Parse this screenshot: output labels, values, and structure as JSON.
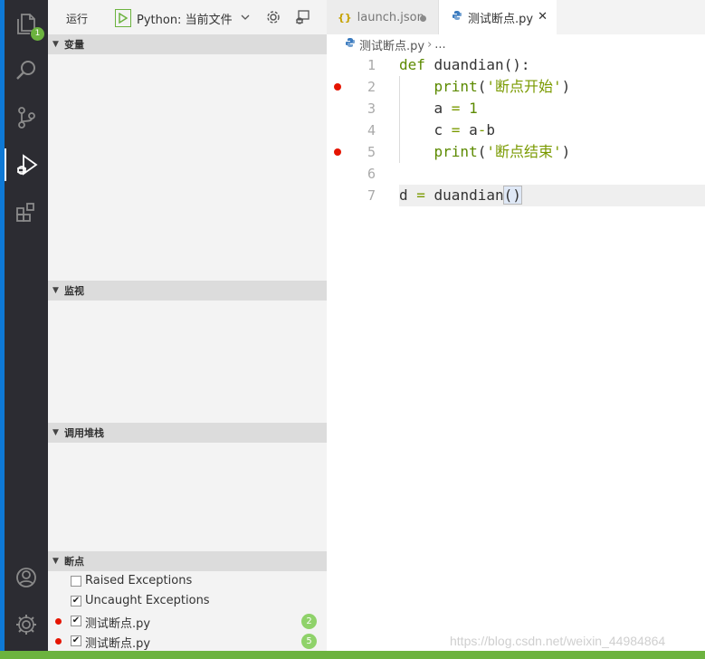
{
  "activity_bar": {
    "items": [
      "explorer-icon",
      "search-icon",
      "source-control-icon",
      "debug-icon",
      "extensions-icon",
      "account-icon",
      "settings-gear-icon"
    ],
    "explorer_badge": "1"
  },
  "debug_toolbar": {
    "run_label": "运行",
    "config": "Python: 当前文件",
    "icons": [
      "play-icon",
      "chevron-down-icon",
      "gear-icon",
      "debug-console-icon"
    ]
  },
  "sections": {
    "variables": "变量",
    "watch": "监视",
    "call_stack": "调用堆栈",
    "breakpoints": "断点"
  },
  "breakpoints": [
    {
      "label": "Raised Exceptions",
      "checked": false
    },
    {
      "label": "Uncaught Exceptions",
      "checked": true
    },
    {
      "label": "测试断点.py",
      "checked": true,
      "line": "2"
    },
    {
      "label": "测试断点.py",
      "checked": true,
      "line": "5"
    }
  ],
  "tabs": [
    {
      "label": "launch.json",
      "modified": true
    },
    {
      "label": "测试断点.py",
      "active": true
    }
  ],
  "breadcrumb": {
    "file": "测试断点.py",
    "more": "..."
  },
  "code": {
    "line_numbers": [
      "1",
      "2",
      "3",
      "4",
      "5",
      "6",
      "7"
    ],
    "breakpoint_lines": [
      2,
      5
    ],
    "current_line": 7
  },
  "colors": {
    "accent": "#0e79d6",
    "status_bar": "#6cb33f",
    "breakpoint": "#e51400",
    "keyword": "#5c8a00"
  },
  "watermark": "https://blog.csdn.net/weixin_44984864"
}
